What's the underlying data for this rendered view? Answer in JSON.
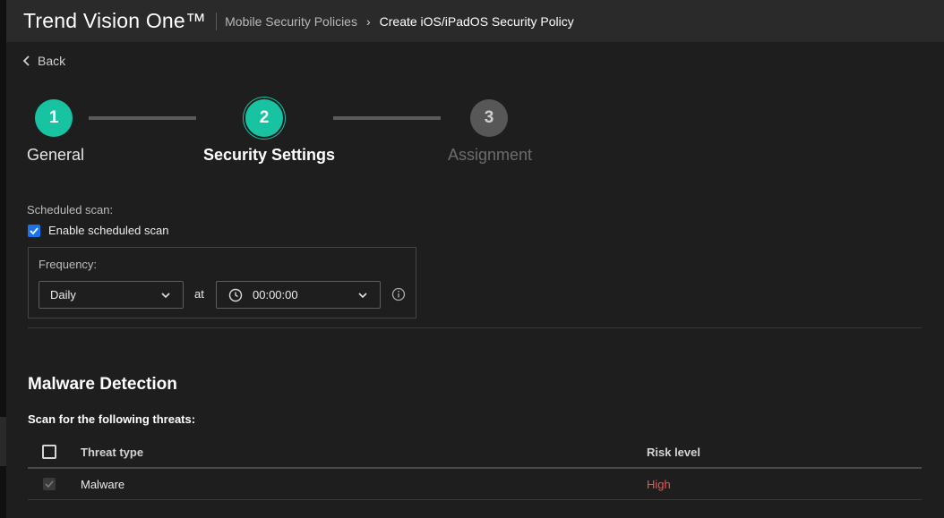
{
  "app": {
    "title": "Trend Vision One™"
  },
  "breadcrumb": {
    "parent": "Mobile Security Policies",
    "separator": "›",
    "current": "Create iOS/iPadOS Security Policy"
  },
  "back_label": "Back",
  "stepper": {
    "steps": [
      {
        "number": "1",
        "label": "General",
        "state": "done"
      },
      {
        "number": "2",
        "label": "Security Settings",
        "state": "active"
      },
      {
        "number": "3",
        "label": "Assignment",
        "state": "pending"
      }
    ]
  },
  "scheduled_scan": {
    "section_label": "Scheduled scan:",
    "enable_label": "Enable scheduled scan",
    "enabled": true,
    "frequency_label": "Frequency:",
    "frequency_value": "Daily",
    "at_label": "at",
    "time_value": "00:00:00"
  },
  "malware": {
    "title": "Malware Detection",
    "subtitle": "Scan for the following threats:",
    "columns": {
      "threat_type": "Threat type",
      "risk_level": "Risk level"
    },
    "rows": [
      {
        "threat_type": "Malware",
        "risk_level": "High",
        "checked": true,
        "disabled": true
      }
    ]
  },
  "colors": {
    "accent": "#17c3a1",
    "checkbox_blue": "#1a73e8",
    "risk_high": "#ff4d4f"
  }
}
